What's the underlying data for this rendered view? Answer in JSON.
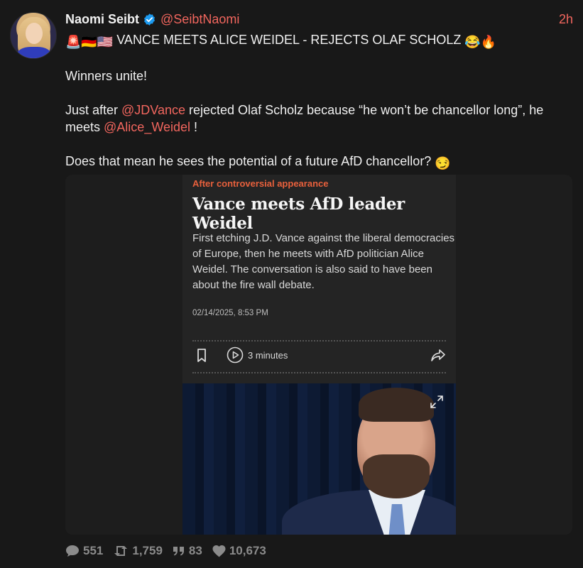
{
  "author": {
    "name": "Naomi Seibt",
    "handle": "@SeibtNaomi",
    "time": "2h"
  },
  "post": {
    "headline_text": "VANCE MEETS ALICE WEIDEL - REJECTS OLAF SCHOLZ",
    "headline_prefix_emoji": "🚨🇩🇪🇺🇸",
    "headline_suffix_emoji": "😂🔥",
    "line1": "Winners unite!",
    "line2_pre": "Just after ",
    "mention1": "@JDVance",
    "line2_post": " rejected Olaf Scholz because “he won’t be chancellor long”, he meets ",
    "mention2": "@Alice_Weidel",
    "line2_end": " !",
    "line3": "Does that mean he sees the potential of a future AfD chancellor?",
    "line3_emoji": "😏"
  },
  "article": {
    "kicker": "After controversial appearance",
    "headline": "Vance meets AfD leader Weidel",
    "summary": "First etching J.D. Vance against the liberal democracies of Europe, then he meets with AfD politician Alice Weidel. The conversation is also said to have been about the fire wall debate.",
    "date": "02/14/2025, 8:53 PM",
    "read_time": "3 minutes"
  },
  "stats": {
    "replies": "551",
    "reposts": "1,759",
    "quotes": "83",
    "likes": "10,673"
  },
  "colors": {
    "accent": "#f2665e",
    "kicker": "#e8603c",
    "background": "#181818"
  }
}
